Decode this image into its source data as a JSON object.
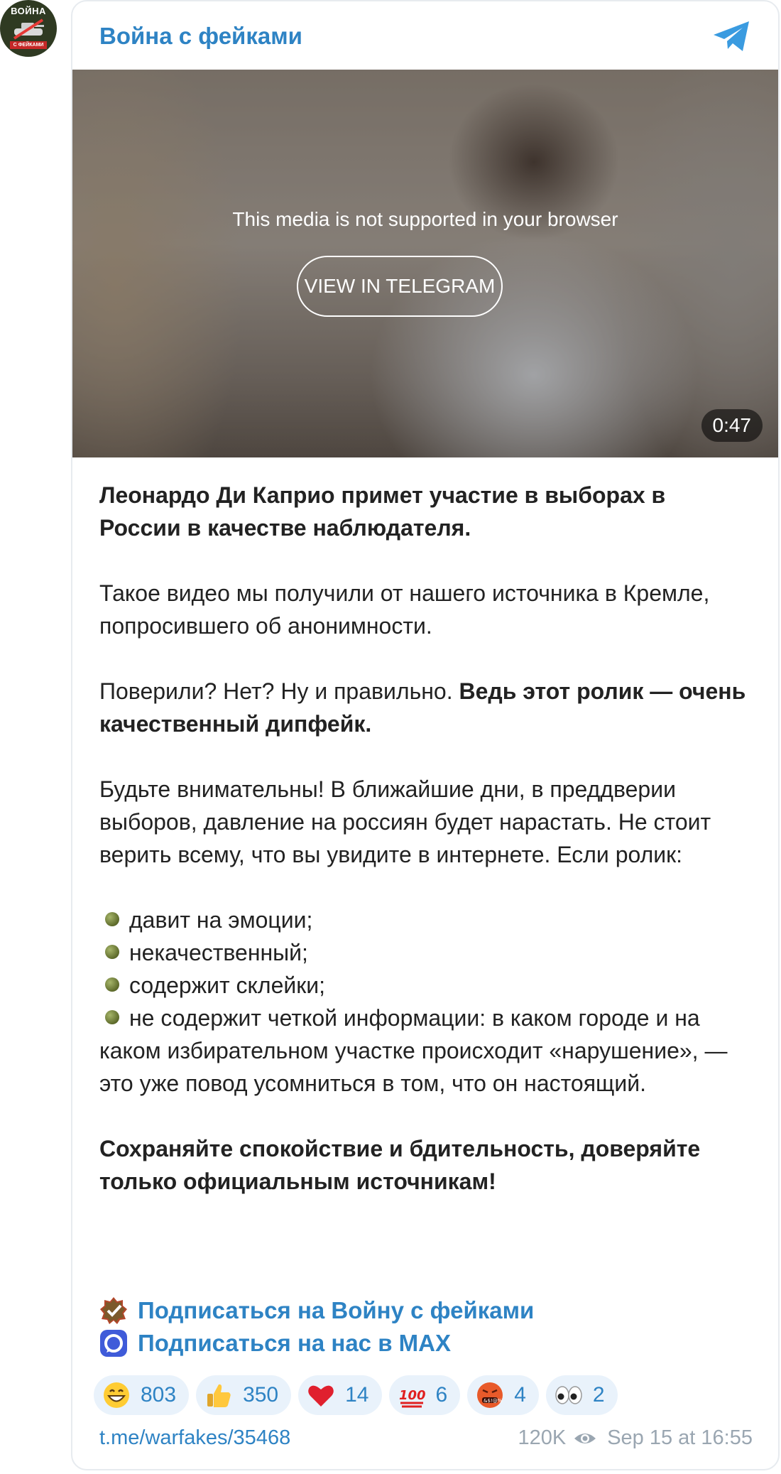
{
  "channel": {
    "name": "Война с фейками",
    "avatar_top": "ВОЙНА",
    "avatar_bottom": "С ФЕЙКАМИ"
  },
  "media": {
    "unsupported_text": "This media is not supported in your browser",
    "view_button": "VIEW IN TELEGRAM",
    "duration": "0:47"
  },
  "post": {
    "headline": "Леонардо Ди Каприо примет участие в выборах в России в качестве наблюдателя.",
    "para1": "Такое видео мы получили от нашего источника в Кремле, попросившего об анонимности.",
    "para2_normal": "Поверили? Нет? Ну и правильно. ",
    "para2_bold": "Ведь этот ролик — очень качественный дипфейк.",
    "para3": "Будьте внимательны! В ближайшие дни, в преддверии выборов, давление на россиян будет нарастать. Не стоит верить всему, что вы увидите в интернете. Если ролик:",
    "bullets": [
      "давит на эмоции;",
      "некачественный;",
      "содержит склейки;",
      "не содержит четкой информации: в каком городе и на каком избирательном участке происходит «нарушение», — это уже повод усомниться в том, что он настоящий."
    ],
    "closing": "Сохраняйте спокойствие и бдительность, доверяйте только официальным источникам!",
    "link1": "Подписаться на Войну с фейками",
    "link2": "Подписаться на нас в MAX"
  },
  "reactions": [
    {
      "emoji": "grinning-face",
      "count": "803"
    },
    {
      "emoji": "thumbs-up",
      "count": "350"
    },
    {
      "emoji": "red-heart",
      "count": "14"
    },
    {
      "emoji": "hundred-points",
      "count": "6"
    },
    {
      "emoji": "face-with-symbols",
      "count": "4"
    },
    {
      "emoji": "eyes",
      "count": "2"
    }
  ],
  "footer": {
    "link": "t.me/warfakes/35468",
    "views": "120K",
    "date": "Sep 15 at 16:55"
  },
  "colors": {
    "accent": "#2e83c4",
    "reaction_bg": "#e9f2fb",
    "meta": "#9aa6b1"
  }
}
